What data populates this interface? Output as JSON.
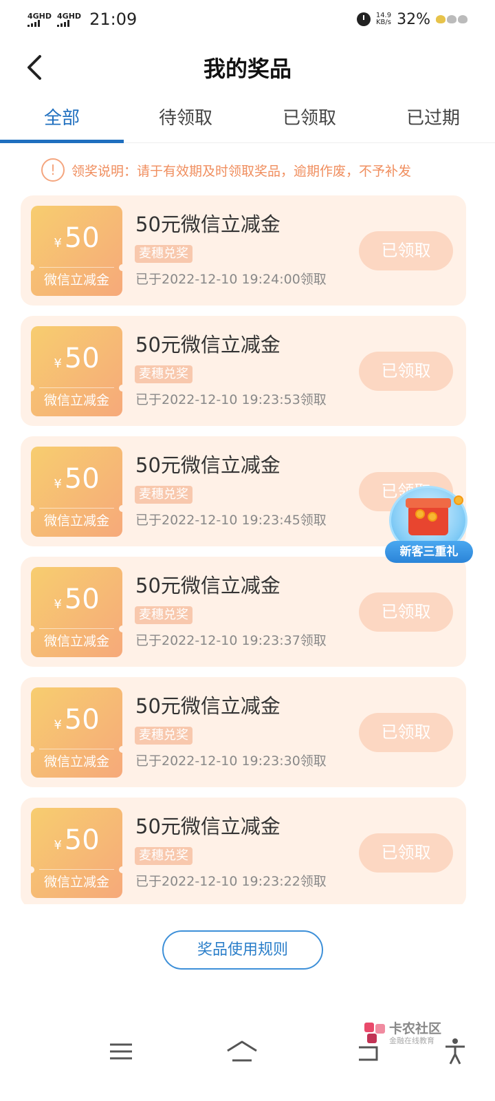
{
  "status_bar": {
    "sim1": "4GHD",
    "sim2": "4GHD",
    "time": "21:09",
    "net_speed_value": "14.9",
    "net_speed_unit": "KB/s",
    "battery": "32%"
  },
  "header": {
    "title": "我的奖品",
    "back_icon": "chevron-left-icon"
  },
  "tabs": [
    {
      "label": "全部",
      "active": true
    },
    {
      "label": "待领取",
      "active": false
    },
    {
      "label": "已领取",
      "active": false
    },
    {
      "label": "已过期",
      "active": false
    }
  ],
  "notice": {
    "icon": "exclamation-circle-icon",
    "text": "领奖说明：请于有效期及时领取奖品，逾期作废，不予补发"
  },
  "prizes": [
    {
      "currency": "¥",
      "amount": "50",
      "coupon_label": "微信立减金",
      "title": "50元微信立减金",
      "tag": "麦穗兑奖",
      "time": "已于2022-12-10 19:24:00领取",
      "button": "已领取"
    },
    {
      "currency": "¥",
      "amount": "50",
      "coupon_label": "微信立减金",
      "title": "50元微信立减金",
      "tag": "麦穗兑奖",
      "time": "已于2022-12-10 19:23:53领取",
      "button": "已领取"
    },
    {
      "currency": "¥",
      "amount": "50",
      "coupon_label": "微信立减金",
      "title": "50元微信立减金",
      "tag": "麦穗兑奖",
      "time": "已于2022-12-10 19:23:45领取",
      "button": "已领取"
    },
    {
      "currency": "¥",
      "amount": "50",
      "coupon_label": "微信立减金",
      "title": "50元微信立减金",
      "tag": "麦穗兑奖",
      "time": "已于2022-12-10 19:23:37领取",
      "button": "已领取"
    },
    {
      "currency": "¥",
      "amount": "50",
      "coupon_label": "微信立减金",
      "title": "50元微信立减金",
      "tag": "麦穗兑奖",
      "time": "已于2022-12-10 19:23:30领取",
      "button": "已领取"
    },
    {
      "currency": "¥",
      "amount": "50",
      "coupon_label": "微信立减金",
      "title": "50元微信立减金",
      "tag": "麦穗兑奖",
      "time": "已于2022-12-10 19:23:22领取",
      "button": "已领取"
    }
  ],
  "promo_float": {
    "label": "新客三重礼",
    "icon": "red-gift-box-icon"
  },
  "rules_button": "奖品使用规则",
  "watermark": {
    "title": "卡农社区",
    "subtitle": "金融在线教育"
  },
  "navbar": {
    "menu_icon": "menu-icon",
    "home_icon": "home-icon",
    "back_icon": "back-arrow-icon",
    "accessibility_icon": "accessibility-icon"
  },
  "colors": {
    "accent_blue": "#1f6fbf",
    "notice_orange": "#f08e5e",
    "card_bg": "#fff1e7",
    "claimed_button": "#fcd7c2"
  }
}
